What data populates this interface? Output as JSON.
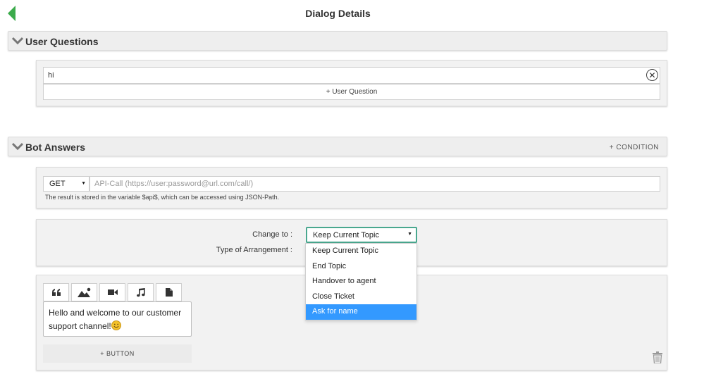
{
  "header": {
    "title": "Dialog Details"
  },
  "user_questions": {
    "title": "User Questions",
    "questions": [
      "hi"
    ],
    "add_label": "+ User Question"
  },
  "bot_answers": {
    "title": "Bot Answers",
    "condition_label": "+ CONDITION",
    "api": {
      "method": "GET",
      "placeholder": "API-Call (https://user:password@url.com/call/)",
      "note": "The result is stored in the variable $api$, which can be accessed using JSON-Path."
    },
    "topic": {
      "change_label": "Change to :",
      "arrangement_label": "Type of Arrangement :",
      "selected": "Keep Current Topic",
      "options": [
        "Keep Current Topic",
        "End Topic",
        "Handover to agent",
        "Close Ticket",
        "Ask for name"
      ],
      "highlighted_index": 4
    },
    "message": {
      "text": "Hello and welcome to our customer support channel!",
      "add_button_label": "+ BUTTON"
    }
  },
  "colors": {
    "accent": "#3cab4c",
    "select_border": "#4aa88f",
    "highlight": "#3399ff"
  }
}
